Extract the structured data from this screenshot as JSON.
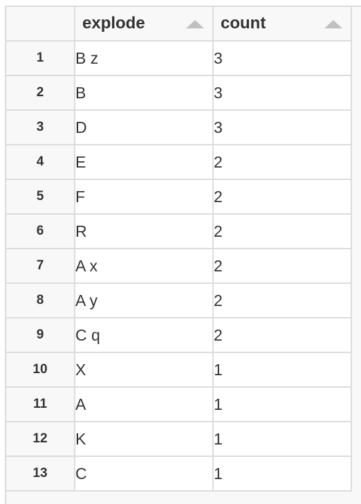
{
  "table": {
    "columns": [
      {
        "label": "explode",
        "sort_icon": "triangle-up"
      },
      {
        "label": "count",
        "sort_icon": "triangle-up"
      }
    ],
    "rows": [
      {
        "index": "1",
        "explode": "B z",
        "count": "3"
      },
      {
        "index": "2",
        "explode": "B",
        "count": "3"
      },
      {
        "index": "3",
        "explode": "D",
        "count": "3"
      },
      {
        "index": "4",
        "explode": "E",
        "count": "2"
      },
      {
        "index": "5",
        "explode": "F",
        "count": "2"
      },
      {
        "index": "6",
        "explode": "R",
        "count": "2"
      },
      {
        "index": "7",
        "explode": "A x",
        "count": "2"
      },
      {
        "index": "8",
        "explode": "A y",
        "count": "2"
      },
      {
        "index": "9",
        "explode": "C q",
        "count": "2"
      },
      {
        "index": "10",
        "explode": "X",
        "count": "1"
      },
      {
        "index": "11",
        "explode": "A",
        "count": "1"
      },
      {
        "index": "12",
        "explode": "K",
        "count": "1"
      },
      {
        "index": "13",
        "explode": "C",
        "count": "1"
      }
    ]
  }
}
